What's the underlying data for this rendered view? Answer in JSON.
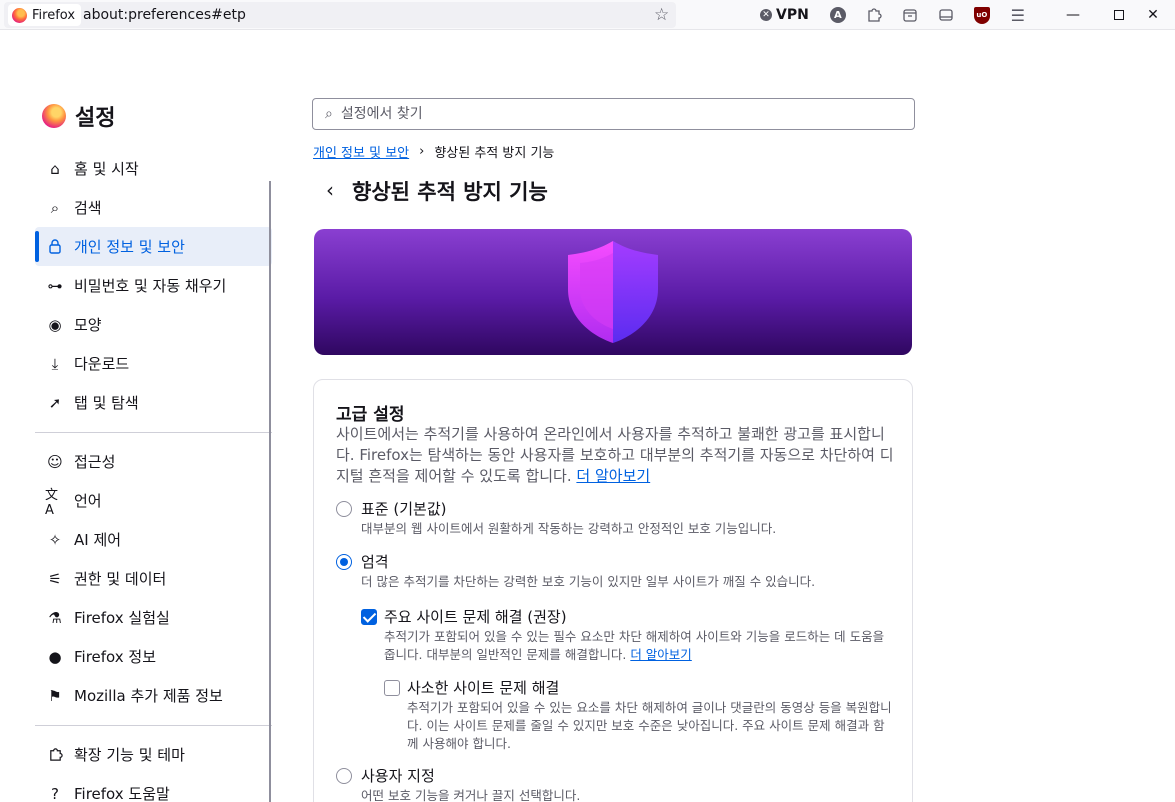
{
  "browser": {
    "identity_label": "Firefox",
    "url": "about:preferences#etp",
    "vpn_label": "VPN",
    "avatar_letter": "A",
    "ublock_label": "uO"
  },
  "sidebar": {
    "title": "설정",
    "items": [
      {
        "label": "홈 및 시작",
        "icon": "home-icon"
      },
      {
        "label": "검색",
        "icon": "search-icon"
      },
      {
        "label": "개인 정보 및 보안",
        "icon": "lock-icon",
        "active": true
      },
      {
        "label": "비밀번호 및 자동 채우기",
        "icon": "key-icon"
      },
      {
        "label": "모양",
        "icon": "eye-icon"
      },
      {
        "label": "다운로드",
        "icon": "download-icon"
      },
      {
        "label": "탭 및 탐색",
        "icon": "cursor-icon"
      }
    ],
    "items2": [
      {
        "label": "접근성",
        "icon": "accessibility-icon"
      },
      {
        "label": "언어",
        "icon": "translate-icon"
      },
      {
        "label": "AI 제어",
        "icon": "sparkle-icon"
      },
      {
        "label": "권한 및 데이터",
        "icon": "permissions-icon"
      },
      {
        "label": "Firefox 실험실",
        "icon": "flask-icon"
      },
      {
        "label": "Firefox 정보",
        "icon": "firefox-icon"
      },
      {
        "label": "Mozilla 추가 제품 정보",
        "icon": "mozilla-icon"
      }
    ],
    "items3": [
      {
        "label": "확장 기능 및 테마",
        "icon": "puzzle-icon"
      },
      {
        "label": "Firefox 도움말",
        "icon": "help-icon"
      }
    ]
  },
  "search": {
    "placeholder": "설정에서 찾기"
  },
  "breadcrumb": {
    "parent": "개인 정보 및 보안",
    "separator": "›",
    "current": "향상된 추적 방지 기능"
  },
  "page": {
    "back": "‹",
    "title": "향상된 추적 방지 기능"
  },
  "advanced": {
    "title": "고급 설정",
    "description": "사이트에서는 추적기를 사용하여 온라인에서 사용자를 추적하고 불쾌한 광고를 표시합니다. Firefox는 탐색하는 동안 사용자를 보호하고 대부분의 추적기를 자동으로 차단하여 디지털 흔적을 제어할 수 있도록 합니다.",
    "learn_more": "더 알아보기",
    "options": {
      "standard": {
        "label": "표준 (기본값)",
        "description": "대부분의 웹 사이트에서 원활하게 작동하는 강력하고 안정적인 보호 기능입니다.",
        "checked": false
      },
      "strict": {
        "label": "엄격",
        "description": "더 많은 추적기를 차단하는 강력한 보호 기능이 있지만 일부 사이트가 깨질 수 있습니다.",
        "checked": true
      },
      "custom": {
        "label": "사용자 지정",
        "description": "어떤 보호 기능을 켜거나 끌지 선택합니다.",
        "checked": false
      }
    },
    "major_fix": {
      "label": "주요 사이트 문제 해결 (권장)",
      "description": "추적기가 포함되어 있을 수 있는 필수 요소만 차단 해제하여 사이트와 기능을 로드하는 데 도움을 줍니다. 대부분의 일반적인 문제를 해결합니다.",
      "learn_more": "더 알아보기",
      "checked": true
    },
    "minor_fix": {
      "label": "사소한 사이트 문제 해결",
      "description": "추적기가 포함되어 있을 수 있는 요소를 차단 해제하여 글이나 댓글란의 동영상 등을 복원합니다. 이는 사이트 문제를 줄일 수 있지만 보호 수준은 낮아집니다. 주요 사이트 문제 해결과 함께 사용해야 합니다.",
      "checked": false
    }
  }
}
